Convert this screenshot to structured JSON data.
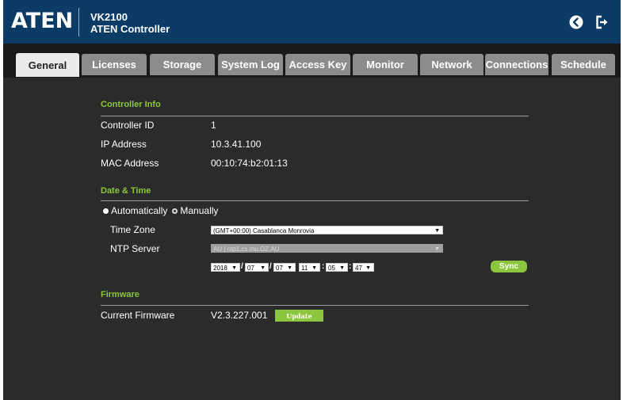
{
  "header": {
    "logo_text": "ATEN",
    "model": "VK2100",
    "product": "ATEN Controller",
    "back_icon": "back-arrow-circle-icon",
    "logout_icon": "logout-icon"
  },
  "tabs": [
    {
      "label": "General",
      "active": true
    },
    {
      "label": "Licenses",
      "active": false
    },
    {
      "label": "Storage",
      "active": false
    },
    {
      "label": "System Log",
      "active": false
    },
    {
      "label": "Access Key",
      "active": false
    },
    {
      "label": "Monitor",
      "active": false
    },
    {
      "label": "Network",
      "active": false
    },
    {
      "label": "Connections",
      "active": false
    },
    {
      "label": "Schedule",
      "active": false
    }
  ],
  "controller_info": {
    "title": "Controller Info",
    "rows": [
      {
        "label": "Controller ID",
        "value": "1"
      },
      {
        "label": "IP Address",
        "value": "10.3.41.100"
      },
      {
        "label": "MAC Address",
        "value": "00:10:74:b2:01:13"
      }
    ]
  },
  "date_time": {
    "title": "Date & Time",
    "mode_auto_label": "Automatically",
    "mode_manual_label": "Manually",
    "selected_mode": "Automatically",
    "time_zone_label": "Time Zone",
    "time_zone_value": "(GMT+00:00) Casablanca Monrovia",
    "ntp_label": "NTP Server",
    "ntp_value": "AU | ntp1.cs.mu.OZ.AU",
    "date": {
      "year": "2018",
      "month": "07",
      "day": "07",
      "hour": "11",
      "minute": "05",
      "second": "47",
      "date_sep": "/",
      "time_sep": ":"
    },
    "sync_label": "Sync"
  },
  "firmware": {
    "title": "Firmware",
    "current_label": "Current Firmware",
    "current_value": "V2.3.227.001",
    "update_label": "Update"
  },
  "colors": {
    "header_bg": "#0c3c66",
    "accent_green": "#8cc63f",
    "content_bg": "#2b2b2b",
    "tab_inactive": "#8c8c8c",
    "tab_active": "#ebebeb"
  }
}
